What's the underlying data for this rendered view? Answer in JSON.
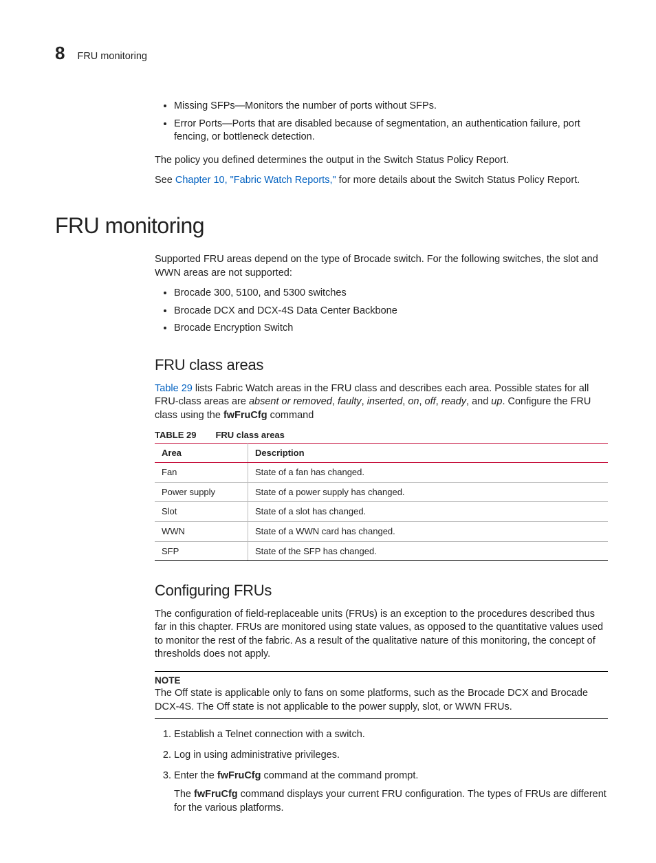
{
  "header": {
    "chapter_number": "8",
    "running_head": "FRU monitoring"
  },
  "intro_bullets": [
    "Missing SFPs—Monitors the number of ports without SFPs.",
    "Error Ports—Ports that are disabled because of segmentation, an authentication failure, port fencing, or bottleneck detection."
  ],
  "intro_para1": "The policy you defined determines the output in the Switch Status Policy Report.",
  "intro_para2_pre": "See ",
  "intro_para2_link": "Chapter 10, \"Fabric Watch Reports,\"",
  "intro_para2_post": " for more details about the Switch Status Policy Report.",
  "section_title": "FRU monitoring",
  "section_intro": "Supported FRU areas depend on the type of Brocade switch. For the following switches, the slot and WWN areas are not supported:",
  "section_bullets": [
    "Brocade 300, 5100, and 5300 switches",
    "Brocade DCX and DCX-4S Data Center Backbone",
    "Brocade Encryption Switch"
  ],
  "sub1_title": "FRU class areas",
  "sub1_para_pre": "",
  "sub1_para_link": "Table 29",
  "sub1_para_mid": " lists Fabric Watch areas in the FRU class and describes each area. Possible states for all FRU-class areas are ",
  "sub1_states": [
    "absent or removed",
    "faulty",
    "inserted",
    "on",
    "off",
    "ready",
    "up"
  ],
  "sub1_para_post1": ". Configure the FRU class using the ",
  "sub1_cmd": "fwFruCfg",
  "sub1_para_post2": " command",
  "table_number": "TABLE 29",
  "table_title": "FRU class areas",
  "table_cols": [
    "Area",
    "Description"
  ],
  "table_rows": [
    {
      "area": "Fan",
      "desc": "State of a fan has changed."
    },
    {
      "area": "Power supply",
      "desc": "State of a power supply has changed."
    },
    {
      "area": "Slot",
      "desc": "State of a slot has changed."
    },
    {
      "area": "WWN",
      "desc": "State of a WWN card has changed."
    },
    {
      "area": "SFP",
      "desc": "State of the SFP has changed."
    }
  ],
  "sub2_title": "Configuring FRUs",
  "sub2_para": "The configuration of field-replaceable units (FRUs) is an exception to the procedures described thus far in this chapter. FRUs are monitored using state values, as opposed to the quantitative values used to monitor the rest of the fabric. As a result of the qualitative nature of this monitoring, the concept of thresholds does not apply.",
  "note_label": "NOTE",
  "note_text": "The Off state is applicable only to fans on some platforms, such as the Brocade DCX and Brocade DCX-4S. The Off state is not applicable to the power supply, slot, or WWN FRUs.",
  "steps": {
    "s1": "Establish a Telnet connection with a switch.",
    "s2": "Log in using administrative privileges.",
    "s3_pre": "Enter the ",
    "s3_cmd": "fwFruCfg",
    "s3_post": " command at the command prompt.",
    "s3_follow_pre": "The ",
    "s3_follow_cmd": "fwFruCfg",
    "s3_follow_post": " command displays your current FRU configuration. The types of FRUs are different for the various platforms."
  }
}
